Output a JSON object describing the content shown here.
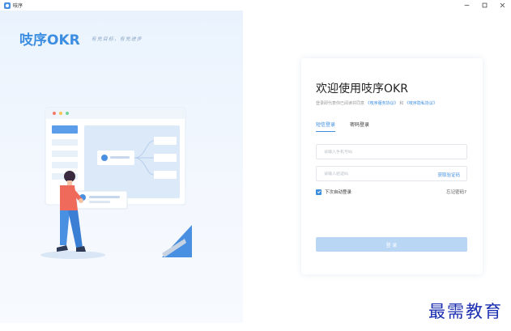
{
  "window": {
    "title": "吱序",
    "controls": [
      "minimize-icon",
      "maximize-icon",
      "close-icon"
    ]
  },
  "brand": {
    "logo": "吱序OKR",
    "slogan": "有充目标，有充进步"
  },
  "login": {
    "title": "欢迎使用吱序OKR",
    "agreement_prefix": "登录即代表你已阅读并同意",
    "service_link": "《吱序服务协议》",
    "and_text": "和",
    "privacy_link": "《吱序隐私协议》",
    "tabs": [
      {
        "label": "短信登录",
        "active": true
      },
      {
        "label": "密码登录",
        "active": false
      }
    ],
    "phone_placeholder": "请输入手机号码",
    "code_placeholder": "请输入验证码",
    "get_code": "获取验证码",
    "remember_label": "下次自动登录",
    "remember_checked": true,
    "forgot": "忘记密码?",
    "submit": "登 录"
  },
  "watermark": "最需教育",
  "colors": {
    "accent": "#3d8ee0",
    "button_disabled": "#b9d6f5",
    "panel_bg": "#eaf3fd",
    "watermark": "#1b2fb0"
  }
}
